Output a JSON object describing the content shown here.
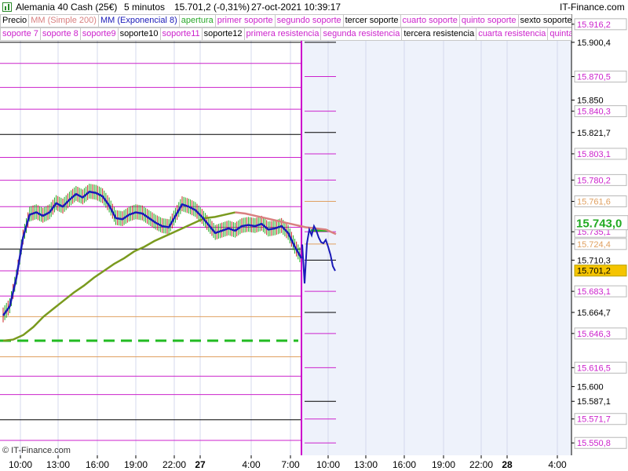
{
  "header": {
    "instrument": "Alemania 40 Cash (25€)",
    "timeframe": "5 minutos",
    "last_price": "15.701,2 (-0,31%)",
    "datetime": "27-oct-2021 10:39:17",
    "brand": "IT-Finance.com"
  },
  "legend_row1": [
    {
      "label": "Precio",
      "color": "#000000"
    },
    {
      "label": "MM (Simple 200)",
      "color": "#d98080"
    },
    {
      "label": "MM (Exponencial 8)",
      "color": "#1a1ab8"
    },
    {
      "label": "apertura",
      "color": "#2aa82a"
    },
    {
      "label": "primer soporte",
      "color": "#cc22cc"
    },
    {
      "label": "segundo soporte",
      "color": "#cc22cc"
    },
    {
      "label": "tercer soporte",
      "color": "#000000"
    },
    {
      "label": "cuarto soporte",
      "color": "#cc22cc"
    },
    {
      "label": "quinto soporte",
      "color": "#cc22cc"
    },
    {
      "label": "sexto soporte",
      "color": "#000000"
    }
  ],
  "legend_row2": [
    {
      "label": "soporte 7",
      "color": "#cc22cc"
    },
    {
      "label": "soporte 8",
      "color": "#cc22cc"
    },
    {
      "label": "soporte9",
      "color": "#cc22cc"
    },
    {
      "label": "soporte10",
      "color": "#000000"
    },
    {
      "label": "soporte11",
      "color": "#cc22cc"
    },
    {
      "label": "soporte12",
      "color": "#000000"
    },
    {
      "label": "primera resistencia",
      "color": "#cc22cc"
    },
    {
      "label": "segunda resistencia",
      "color": "#cc22cc"
    },
    {
      "label": "tercera resistencia",
      "color": "#000000"
    },
    {
      "label": "cuarta resistencia",
      "color": "#cc22cc"
    },
    {
      "label": "quinta resistencia",
      "color": "#cc22cc"
    }
  ],
  "copyright": "© IT-Finance.com",
  "chart_data": {
    "type": "line",
    "ylim": [
      15540,
      15925
    ],
    "x_ticks": [
      "10:00",
      "13:00",
      "16:00",
      "19:00",
      "22:00",
      "27",
      "4:00",
      "7:00",
      "10:00",
      "13:00",
      "16:00",
      "19:00",
      "22:00",
      "28",
      "4:00"
    ],
    "y_labels": [
      {
        "value": 15916.2,
        "text": "15.916,2",
        "color": "#cc22cc"
      },
      {
        "value": 15900.4,
        "text": "15.900,4",
        "color": "#000000"
      },
      {
        "value": 15870.5,
        "text": "15.870,5",
        "color": "#cc22cc"
      },
      {
        "value": 15850,
        "text": "15.850",
        "color": "#000000"
      },
      {
        "value": 15840.3,
        "text": "15.840,3",
        "color": "#cc22cc"
      },
      {
        "value": 15821.7,
        "text": "15.821,7",
        "color": "#000000"
      },
      {
        "value": 15803.1,
        "text": "15.803,1",
        "color": "#cc22cc"
      },
      {
        "value": 15780.2,
        "text": "15.780,2",
        "color": "#cc22cc"
      },
      {
        "value": 15761.6,
        "text": "15.761,6",
        "color": "#e0a060"
      },
      {
        "value": 15735.1,
        "text": "15.735,1",
        "color": "#cc22cc"
      },
      {
        "value": 15724.4,
        "text": "15.724,4",
        "color": "#e0a060"
      },
      {
        "value": 15710.3,
        "text": "15.710,3",
        "color": "#000000"
      },
      {
        "value": 15683.1,
        "text": "15.683,1",
        "color": "#cc22cc"
      },
      {
        "value": 15664.7,
        "text": "15.664,7",
        "color": "#000000"
      },
      {
        "value": 15646.3,
        "text": "15.646,3",
        "color": "#cc22cc"
      },
      {
        "value": 15616.5,
        "text": "15.616,5",
        "color": "#cc22cc"
      },
      {
        "value": 15600,
        "text": "15.600",
        "color": "#000000"
      },
      {
        "value": 15587.1,
        "text": "15.587,1",
        "color": "#000000"
      },
      {
        "value": 15571.7,
        "text": "15.571,7",
        "color": "#cc22cc"
      },
      {
        "value": 15550.8,
        "text": "15.550,8",
        "color": "#cc22cc"
      }
    ],
    "current_price": {
      "value": 15701.2,
      "text": "15.701,2"
    },
    "opening": {
      "value": 15743.0,
      "text": "15.743,0"
    },
    "prev_levels": [
      {
        "value": 15916.2,
        "color": "#cc22cc"
      },
      {
        "value": 15900.4,
        "color": "#000000"
      },
      {
        "value": 15882.0,
        "color": "#cc22cc"
      },
      {
        "value": 15861.0,
        "color": "#cc22cc"
      },
      {
        "value": 15842.0,
        "color": "#cc22cc"
      },
      {
        "value": 15820.0,
        "color": "#000000"
      },
      {
        "value": 15800.0,
        "color": "#cc22cc"
      },
      {
        "value": 15780.0,
        "color": "#cc22cc"
      },
      {
        "value": 15757.0,
        "color": "#cc22cc"
      },
      {
        "value": 15739.0,
        "color": "#cc22cc"
      },
      {
        "value": 15720.0,
        "color": "#000000"
      },
      {
        "value": 15701.0,
        "color": "#cc22cc"
      },
      {
        "value": 15679.0,
        "color": "#cc22cc"
      },
      {
        "value": 15661.0,
        "color": "#e0a060"
      },
      {
        "value": 15626.0,
        "color": "#e0a060"
      },
      {
        "value": 15609.0,
        "color": "#cc22cc"
      },
      {
        "value": 15593.0,
        "color": "#cc22cc"
      },
      {
        "value": 15571.0,
        "color": "#000000"
      },
      {
        "value": 15553.0,
        "color": "#cc22cc"
      }
    ],
    "prev_opening": 15640,
    "ema8": [
      15662,
      15670,
      15695,
      15730,
      15750,
      15752,
      15749,
      15752,
      15760,
      15757,
      15763,
      15768,
      15765,
      15770,
      15769,
      15766,
      15758,
      15747,
      15746,
      15750,
      15752,
      15751,
      15747,
      15743,
      15740,
      15739,
      15749,
      15759,
      15757,
      15754,
      15748,
      15741,
      15734,
      15736,
      15738,
      15736,
      15740,
      15741,
      15740,
      15742,
      15737,
      15738,
      15740,
      15734,
      15722,
      15712
    ],
    "sma200": [
      15640,
      15641,
      15645,
      15652,
      15661,
      15668,
      15675,
      15682,
      15688,
      15695,
      15701,
      15707,
      15712,
      15718,
      15722,
      15727,
      15731,
      15735,
      15739,
      15743,
      15747,
      15748,
      15750,
      15752,
      15751,
      15749,
      15747,
      15745,
      15743,
      15741,
      15739,
      15738,
      15737,
      15733
    ],
    "today_price": [
      15724,
      15690,
      15725,
      15737,
      15732,
      15740,
      15736,
      15730,
      15726,
      15725,
      15728,
      15722,
      15715,
      15705,
      15701
    ]
  }
}
